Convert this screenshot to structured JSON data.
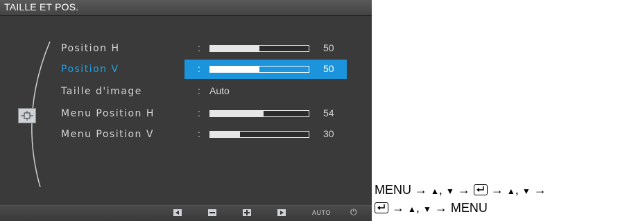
{
  "osd": {
    "title": "TAILLE ET POS.",
    "items": [
      {
        "label": "Position H",
        "value": "50",
        "level": 0.5
      },
      {
        "label": "Position V",
        "value": "50",
        "level": 0.5,
        "selected": true
      },
      {
        "label": "Taille d'image",
        "value": "Auto"
      },
      {
        "label": "Menu Position H",
        "value": "54",
        "level": 0.54
      },
      {
        "label": "Menu Position V",
        "value": "30",
        "level": 0.3
      }
    ],
    "colon": ":",
    "bottom_bar": {
      "auto_label": "AUTO",
      "power_glyph": "⏻"
    },
    "colors": {
      "highlight": "#1c94dc",
      "selected_text": "#1ea0e6",
      "background": "#3a3a3a"
    }
  },
  "instructions": {
    "line1": {
      "menu": "MENU",
      "arrow": "→",
      "up": "▲",
      "sep": ",",
      "down": "▼"
    },
    "line2": {
      "arrow": "→",
      "up": "▲",
      "sep": ",",
      "down": "▼",
      "menu": "MENU"
    }
  }
}
